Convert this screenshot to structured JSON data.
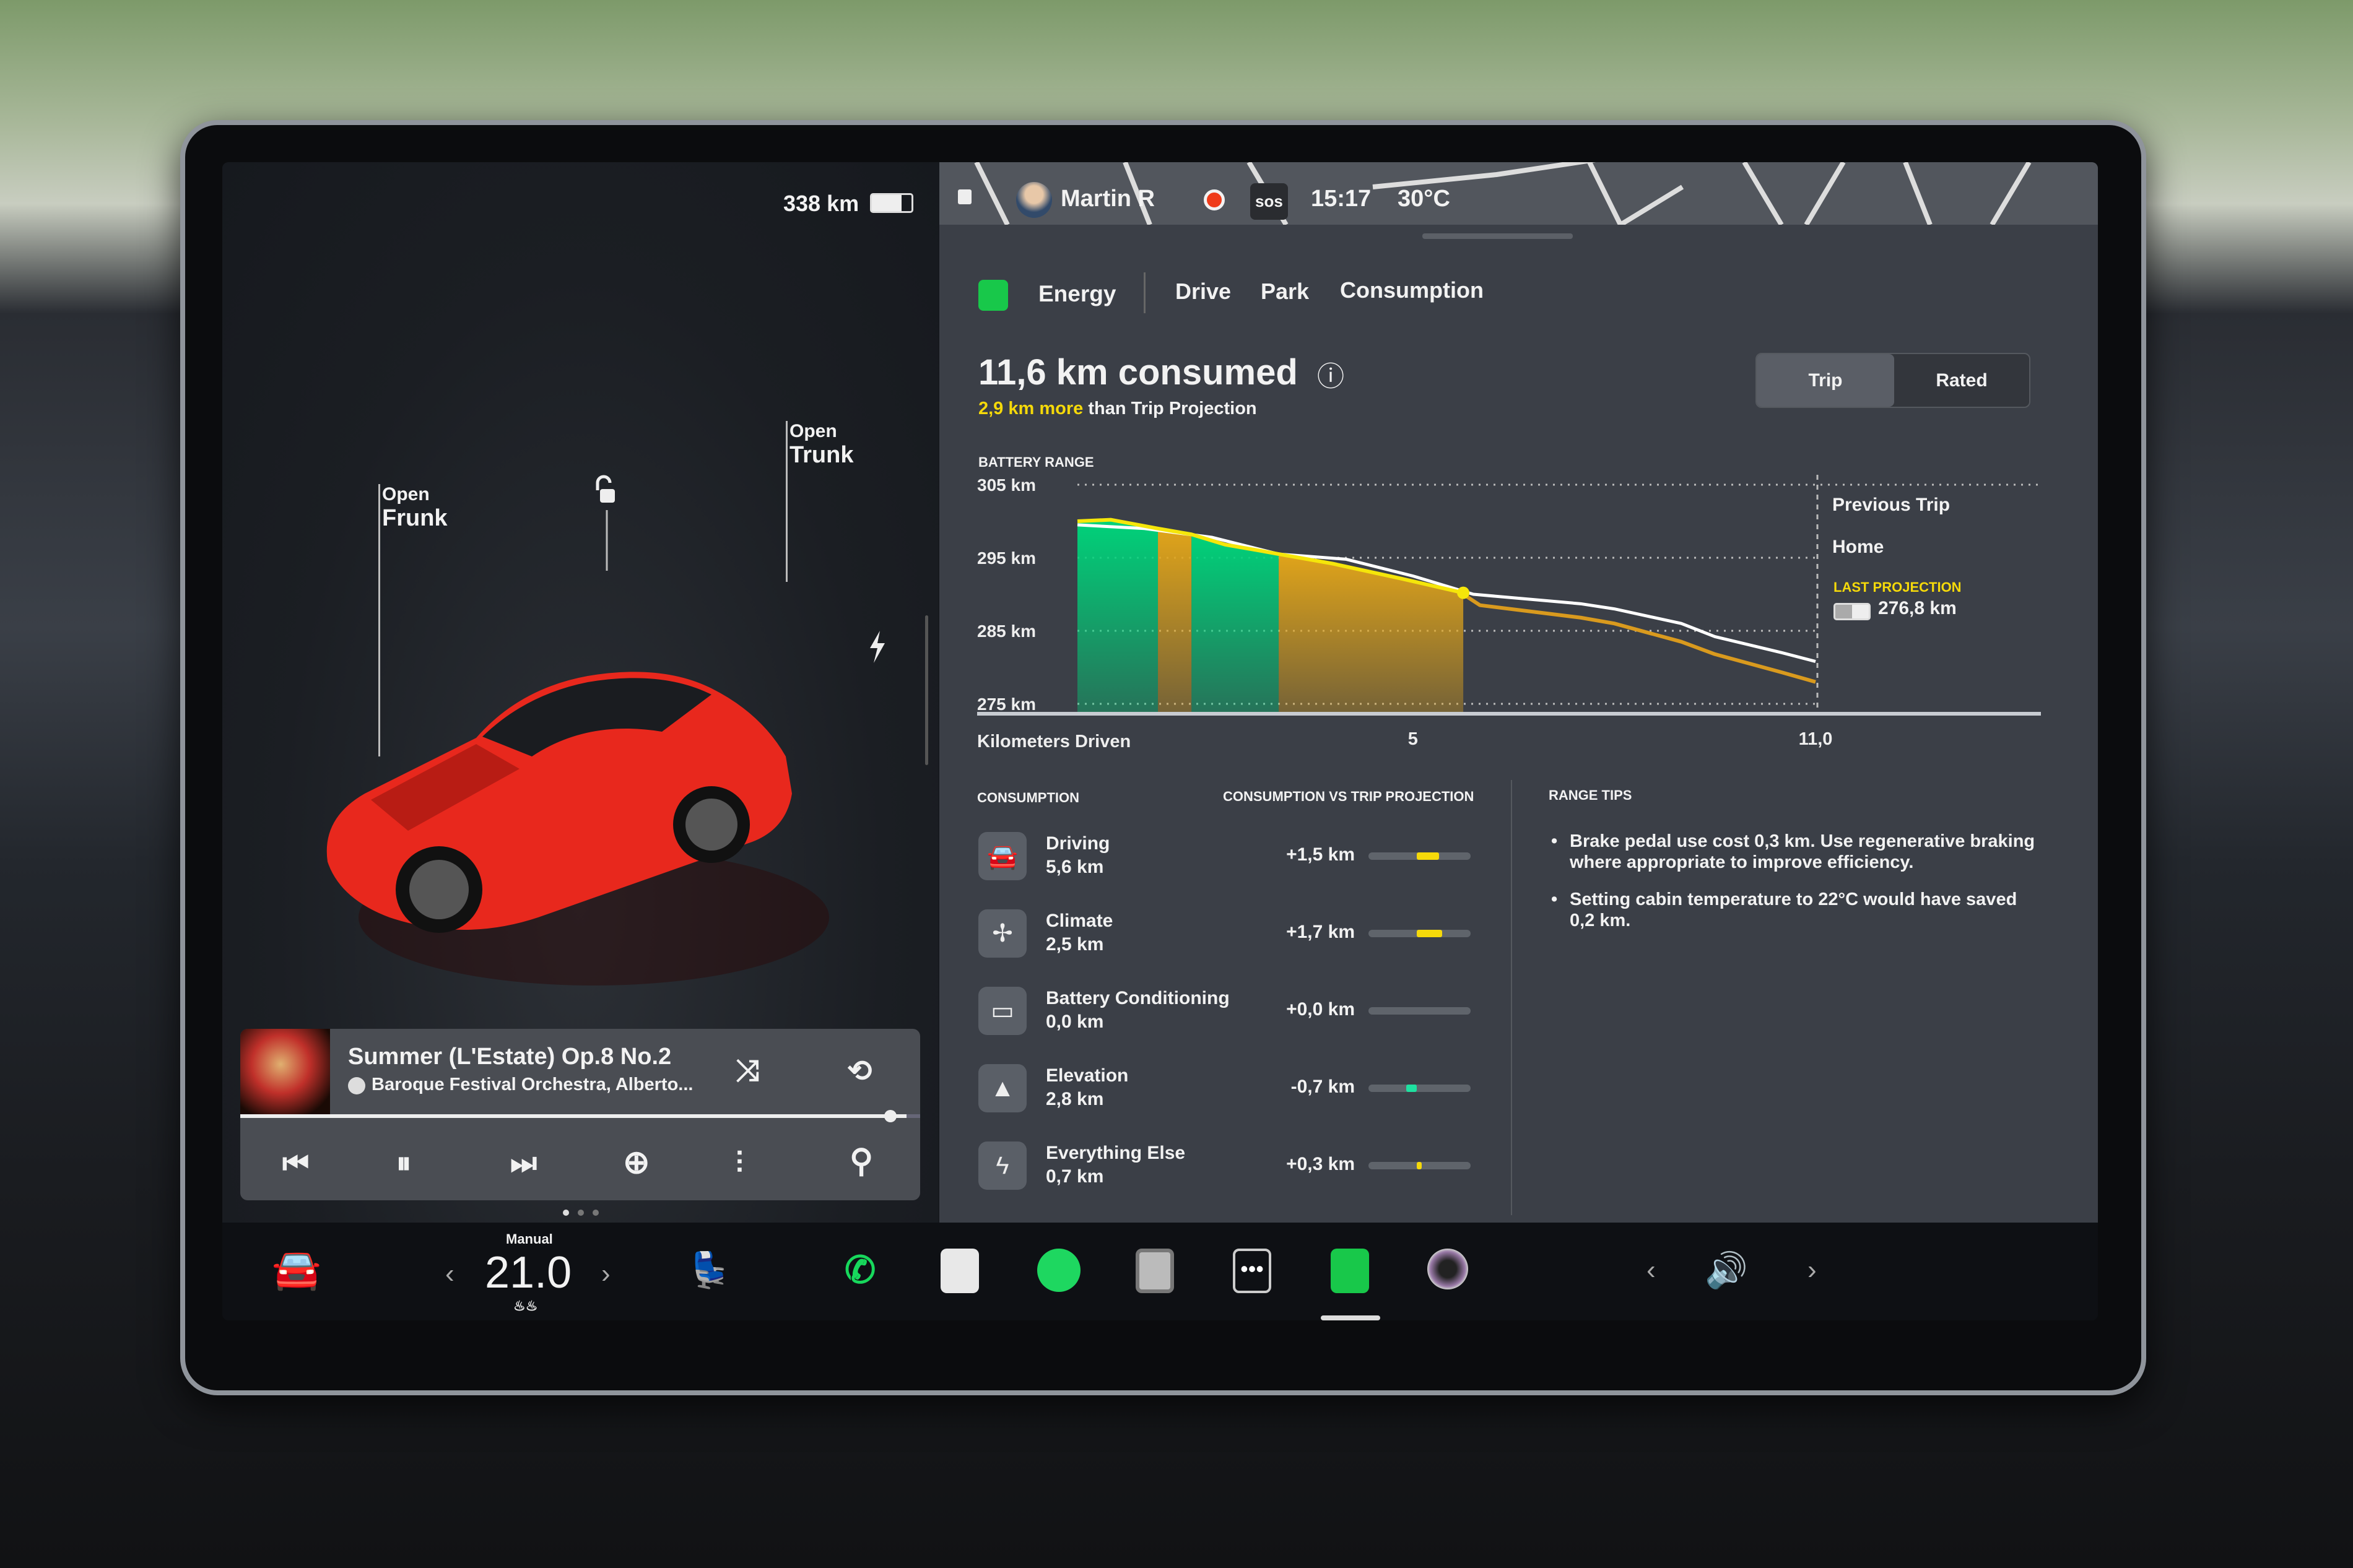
{
  "left_panel": {
    "range": "338 km",
    "frunk": {
      "line1": "Open",
      "line2": "Frunk"
    },
    "trunk": {
      "line1": "Open",
      "line2": "Trunk"
    }
  },
  "media": {
    "title": "Summer (L'Estate) Op.8 No.2",
    "artist": "Baroque Festival Orchestra, Alberto...",
    "progress": 0.98,
    "source_icon": "spotify-icon"
  },
  "status_bar": {
    "user": "Martin R",
    "sos": "SOS",
    "time": "15:17",
    "temperature": "30°C"
  },
  "tabs": [
    {
      "label": "Energy",
      "active": true
    },
    {
      "label": "Drive"
    },
    {
      "label": "Park"
    },
    {
      "label": "Consumption"
    }
  ],
  "summary": {
    "title": "11,6 km consumed",
    "delta": "2,9 km more",
    "delta_suffix": " than Trip Projection"
  },
  "toggle": {
    "options": [
      "Trip",
      "Rated"
    ],
    "selected": "Trip"
  },
  "chart_data": {
    "type": "line",
    "title": "BATTERY RANGE",
    "xlabel": "Kilometers Driven",
    "x_ticks": [
      "5",
      "11,0"
    ],
    "y_ticks": [
      "305 km",
      "295 km",
      "285 km",
      "275 km"
    ],
    "xlim": [
      0,
      11
    ],
    "ylim": [
      275,
      305
    ],
    "grid": true,
    "series": [
      {
        "name": "Trip",
        "x": [
          0,
          0.5,
          1.2,
          1.7,
          2.2,
          2.7,
          3.0,
          3.8,
          4.8,
          5.75
        ],
        "y": [
          300,
          300.2,
          299,
          298.2,
          296.8,
          296,
          295.5,
          294.2,
          292.2,
          290.2
        ],
        "segments": [
          {
            "from": 0,
            "to": 1.2,
            "color": "#00d27a"
          },
          {
            "from": 1.2,
            "to": 1.7,
            "color": "#e0a41a"
          },
          {
            "from": 1.7,
            "to": 3.0,
            "color": "#00d27a"
          },
          {
            "from": 3.0,
            "to": 5.75,
            "color": "#e0a41a"
          }
        ]
      },
      {
        "name": "Home",
        "x": [
          0,
          1,
          2,
          3,
          4,
          5,
          5.9,
          7.5,
          8,
          9,
          9.5,
          10.5,
          11
        ],
        "y": [
          299.5,
          299,
          297.8,
          295.5,
          294.8,
          292.5,
          290,
          288.7,
          288,
          286,
          284.2,
          282,
          280.8
        ],
        "color": "#ffffff"
      },
      {
        "name": "LAST PROJECTION",
        "x": [
          5.75,
          6,
          7.5,
          8,
          9,
          9.5,
          10.5,
          11
        ],
        "y": [
          290,
          288.5,
          286.8,
          286,
          283.5,
          281.8,
          279.3,
          278
        ],
        "color": "#d99a1e",
        "value": "276,8 km"
      }
    ],
    "legend": [
      "Previous Trip",
      "Home"
    ]
  },
  "consumption": {
    "header": "CONSUMPTION",
    "vs_header": "CONSUMPTION VS TRIP PROJECTION",
    "rows": [
      {
        "name": "Driving",
        "value": "5,6 km",
        "delta": "+1,5 km",
        "delta_num": 1.5,
        "icon": "car-icon",
        "color": "#f5d90a"
      },
      {
        "name": "Climate",
        "value": "2,5 km",
        "delta": "+1,7 km",
        "delta_num": 1.7,
        "icon": "fan-icon",
        "color": "#f5d90a"
      },
      {
        "name": "Battery Conditioning",
        "value": "0,0 km",
        "delta": "+0,0 km",
        "delta_num": 0,
        "icon": "battery-icon",
        "color": "#f5d90a"
      },
      {
        "name": "Elevation",
        "value": "2,8 km",
        "delta": "-0,7 km",
        "delta_num": -0.7,
        "icon": "mountain-icon",
        "color": "#1ee0a0"
      },
      {
        "name": "Everything Else",
        "value": "0,7 km",
        "delta": "+0,3 km",
        "delta_num": 0.3,
        "icon": "bolt-icon",
        "color": "#f5d90a"
      }
    ]
  },
  "range_tips": {
    "header": "RANGE TIPS",
    "tips": [
      "Brake pedal use cost 0,3 km. Use regenerative braking where appropriate to improve efficiency.",
      "Setting cabin temperature to 22°C would have saved 0,2 km."
    ]
  },
  "dock": {
    "climate_mode": "Manual",
    "temperature": "21.0",
    "apps": [
      "phone-icon",
      "notes-icon",
      "spotify-icon",
      "dashcam-icon",
      "more-icon",
      "energy-icon",
      "camera-icon"
    ],
    "active_app": "energy-icon"
  },
  "colors": {
    "accent_green": "#00d27a",
    "yellow": "#f5d90a",
    "orange": "#e0a41a",
    "panel": "#3b3f47"
  }
}
